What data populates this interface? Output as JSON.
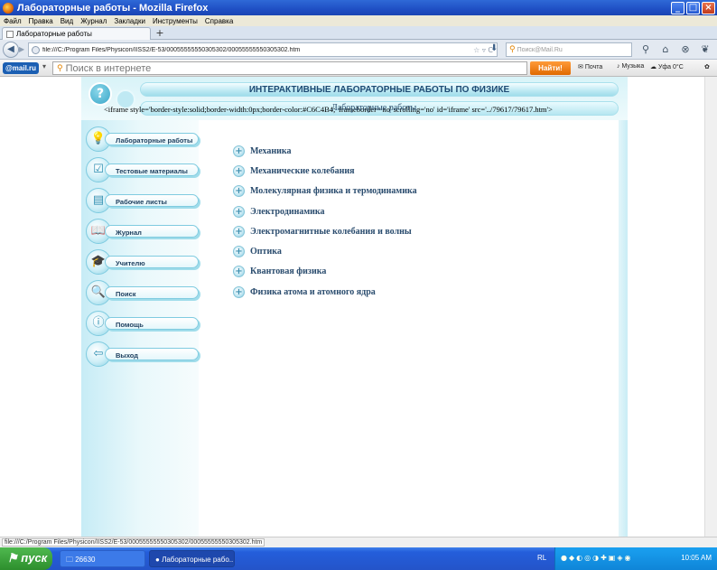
{
  "window": {
    "title": "Лабораторные работы - Mozilla Firefox"
  },
  "menu": [
    "Файл",
    "Правка",
    "Вид",
    "Журнал",
    "Закладки",
    "Инструменты",
    "Справка"
  ],
  "tab": {
    "label": "Лабораторные работы",
    "new_tab": "+"
  },
  "nav": {
    "url": "file:///C:/Program Files/Physicon/IISS2/E-53/00055555550305302/00055555550305302.htm",
    "search_placeholder": "Поиск@Mail.Ru"
  },
  "mailru": {
    "logo": "@mail.ru",
    "search_placeholder": "Поиск в интернете",
    "find_button": "Найти!",
    "mail": "Почта",
    "music": "Музыка",
    "weather": "Уфа 0°C"
  },
  "site": {
    "header_title": "ИНТЕРАКТИВНЫЕ ЛАБОРАТОРНЫЕ РАБОТЫ ПО ФИЗИКЕ",
    "raw_iframe_text": "<iframe style='border-style:solid;border-width:0px;border-color:#C6C4B4;' frameborder='no' scrolling='no' id='iframe' src='../79617/79617.htm'>",
    "subtitle": "Лабораторные работы",
    "menu_items": [
      {
        "label": "Лабораторные работы",
        "icon": "bulb-icon",
        "glyph": "💡"
      },
      {
        "label": "Тестовые материалы",
        "icon": "checkbox-icon",
        "glyph": "☑"
      },
      {
        "label": "Рабочие листы",
        "icon": "worksheet-icon",
        "glyph": "▤"
      },
      {
        "label": "Журнал",
        "icon": "book-icon",
        "glyph": "📖"
      },
      {
        "label": "Учителю",
        "icon": "graduation-cap-icon",
        "glyph": "🎓"
      },
      {
        "label": "Поиск",
        "icon": "search-icon",
        "glyph": "🔍"
      },
      {
        "label": "Помощь",
        "icon": "help-icon",
        "glyph": "ⓘ"
      },
      {
        "label": "Выход",
        "icon": "exit-icon",
        "glyph": "⇦"
      }
    ],
    "topics": [
      "Механика",
      "Механические колебания",
      "Молекулярная физика и термодинамика",
      "Электродинамика",
      "Электромагнитные колебания и волны",
      "Оптика",
      "Квантовая физика",
      "Физика атома и атомного ядра"
    ]
  },
  "status": {
    "text": "file:///C:/Program Files/Physicon/IISS2/E-53/00055555550305302/00055555550305302.htm"
  },
  "taskbar": {
    "start": "пуск",
    "tasks": [
      "26630",
      "Лабораторные рабо..."
    ],
    "lang": "RL",
    "clock": "10:05 AM"
  }
}
